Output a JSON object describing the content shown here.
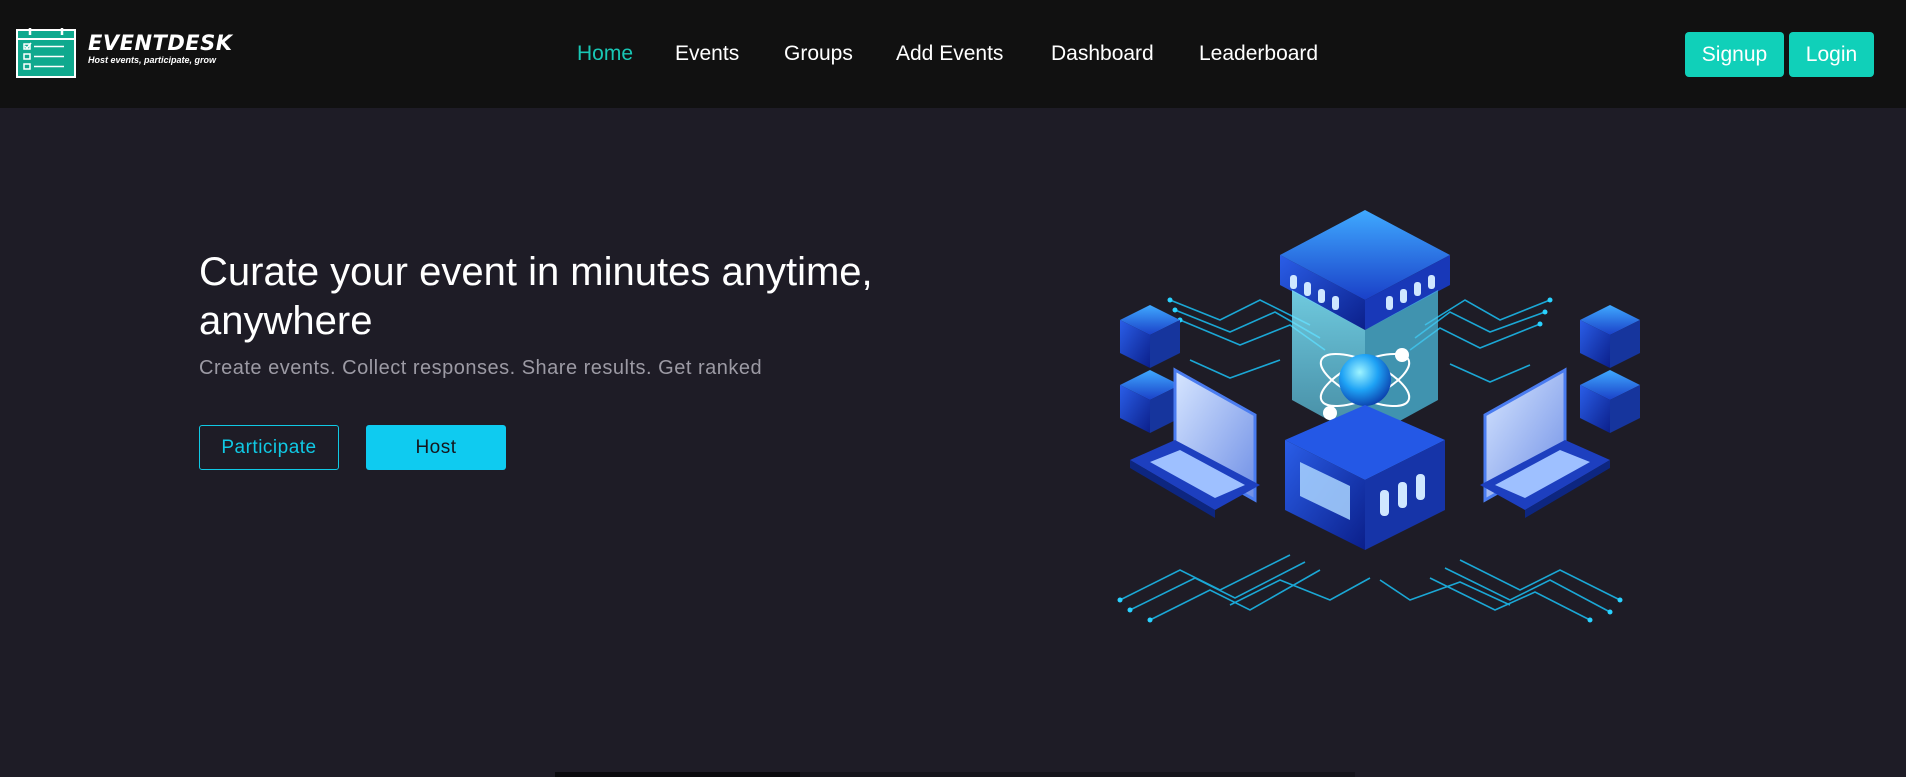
{
  "brand": {
    "name": "EVENTDESK",
    "tagline": "Host events, participate, grow"
  },
  "nav": {
    "items": [
      {
        "label": "Home",
        "active": true
      },
      {
        "label": "Events",
        "active": false
      },
      {
        "label": "Groups",
        "active": false
      },
      {
        "label": "Add Events",
        "active": false
      },
      {
        "label": "Dashboard",
        "active": false
      },
      {
        "label": "Leaderboard",
        "active": false
      }
    ]
  },
  "auth": {
    "signup_label": "Signup",
    "login_label": "Login"
  },
  "hero": {
    "title": "Curate your event in minutes anytime, anywhere",
    "subtitle": "Create events. Collect responses. Share results. Get ranked",
    "participate_label": "Participate",
    "host_label": "Host",
    "illustration_icon": "isometric-server-atom-icon"
  },
  "colors": {
    "accent_teal": "#10d0b9",
    "accent_cyan": "#0fcbf0",
    "active_nav": "#19c7b5",
    "navbar_bg": "#111111",
    "page_bg": "#1e1c26"
  }
}
